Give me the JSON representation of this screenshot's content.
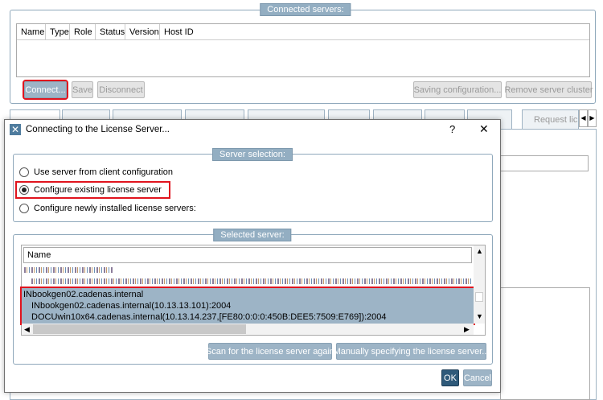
{
  "connected_servers": {
    "title": "Connected servers:",
    "columns": [
      "Name",
      "Type",
      "Role",
      "Status",
      "Version",
      "Host ID"
    ],
    "buttons": {
      "connect": "Connect...",
      "save": "Save",
      "disconnect": "Disconnect",
      "saving_configuration": "Saving configuration...",
      "remove_server_cluster": "Remove server cluster"
    }
  },
  "tabs": {
    "last_visible": "Request lic"
  },
  "dialog": {
    "title": "Connecting to the License Server...",
    "help": "?",
    "close": "✕",
    "server_selection": {
      "title": "Server selection:",
      "options": [
        "Use server from client configuration",
        "Configure existing license server",
        "Configure newly installed license servers:"
      ],
      "selected_index": 1
    },
    "selected_server": {
      "title": "Selected server:",
      "column": "Name",
      "rows": [
        "INbookgen02.cadenas.internal",
        "INbookgen02.cadenas.internal(10.13.13.101):2004",
        "DOCUwin10x64.cadenas.internal(10.13.14.237,[FE80:0:0:0:450B:DEE5:7509:E769]):2004"
      ],
      "scan_button": "Scan for the license server again",
      "manual_button": "Manually specifying the license server..."
    },
    "ok": "OK",
    "cancel": "Cancel"
  },
  "colors": {
    "accent": "#93aec2",
    "highlight_red": "#e0141e",
    "selection": "#9db4c6",
    "ok_button": "#2f5a7a"
  }
}
